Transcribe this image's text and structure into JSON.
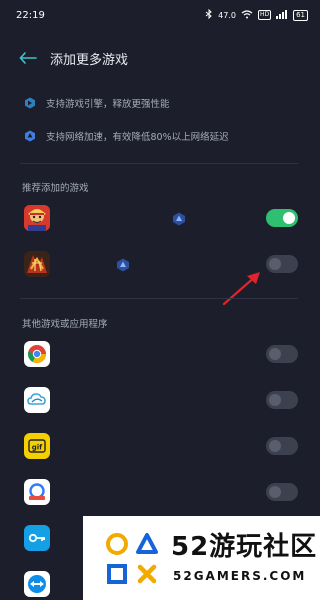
{
  "status_bar": {
    "time": "22:19",
    "net_speed": "47.0",
    "battery": "61"
  },
  "header": {
    "title": "添加更多游戏"
  },
  "features": [
    {
      "text": "支持游戏引擎，释放更强性能",
      "icon": "engine-icon"
    },
    {
      "text": "支持网络加速，有效降低80%以上网络延迟",
      "icon": "network-accel-icon"
    }
  ],
  "recommended": {
    "title": "推荐添加的游戏",
    "items": [
      {
        "icon": "game-icon-1",
        "enabled": true
      },
      {
        "icon": "game-icon-2",
        "enabled": false
      }
    ]
  },
  "others": {
    "title": "其他游戏或应用程序",
    "items": [
      {
        "icon": "chrome-icon",
        "enabled": false
      },
      {
        "icon": "cloud-app-icon",
        "enabled": false
      },
      {
        "icon": "gif-app-icon",
        "enabled": false
      },
      {
        "icon": "blue-app-icon",
        "enabled": false
      },
      {
        "icon": "key-app-icon",
        "enabled": false
      },
      {
        "icon": "teamviewer-icon",
        "enabled": false
      }
    ]
  },
  "watermark": {
    "big": "52游玩社区",
    "small": "52GAMERS.COM"
  },
  "colors": {
    "background": "#1c1f2b",
    "toggle_on": "#2fbf71",
    "accent": "#3e8cf0",
    "arrow": "#e0242b"
  }
}
